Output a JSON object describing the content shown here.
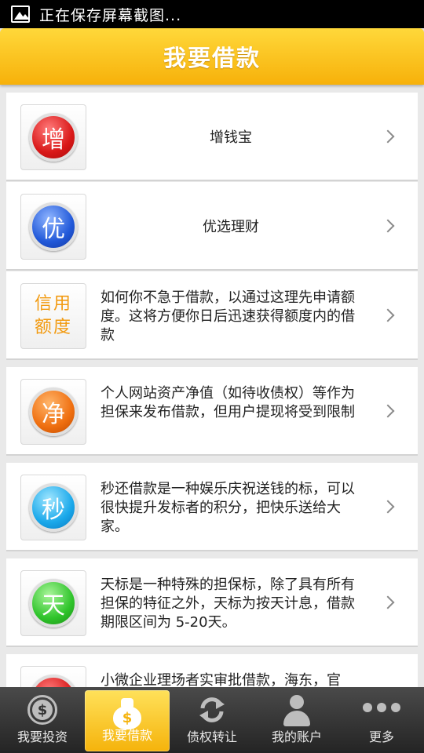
{
  "status_bar": {
    "text": "正在保存屏幕截图..."
  },
  "header": {
    "title": "我要借款"
  },
  "list": [
    {
      "badge": "增",
      "title": "增钱宝",
      "desc": ""
    },
    {
      "badge": "优",
      "title": "优选理财",
      "desc": ""
    },
    {
      "badge": "信用额度",
      "title": "",
      "desc": "如何你不急于借款，以通过这理先申请额度。这将方便你日后迅速获得额度内的借款"
    },
    {
      "badge": "净",
      "title": "",
      "desc": "个人网站资产净值（如待收债权）等作为担保来发布借款，但用户提现将受到限制"
    },
    {
      "badge": "秒",
      "title": "",
      "desc": "秒还借款是一种娱乐庆祝送钱的标，可以很快提升发标者的积分，把快乐送给大家。"
    },
    {
      "badge": "天",
      "title": "",
      "desc": "天标是一种特殊的担保标，除了具有所有担保的特征之外，天标为按天计息，借款期限区间为 5-20天。"
    },
    {
      "badge": "",
      "title": "",
      "desc": "小微企业理场者实审批借款，海东，官"
    }
  ],
  "tabs": [
    {
      "label": "我要投资",
      "icon": "coin-icon"
    },
    {
      "label": "我要借款",
      "icon": "money-bag-icon"
    },
    {
      "label": "债权转让",
      "icon": "transfer-icon"
    },
    {
      "label": "我的账户",
      "icon": "account-icon"
    },
    {
      "label": "更多",
      "icon": "more-icon"
    }
  ],
  "colors": {
    "accent": "#f7b10a",
    "credit_text": "#f29a10"
  }
}
